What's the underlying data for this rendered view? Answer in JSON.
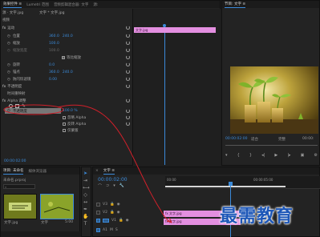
{
  "effect_controls": {
    "tabs": [
      "效果控件 ≡",
      "Lumetri 范围",
      "音频剪辑混合器: 文字",
      "源:"
    ],
    "source_selector": "源 · 文字.jpg",
    "sequence_selector": "文字 * 文字.jpg",
    "section_video": "视频",
    "motion": "运动",
    "position_label": "位置",
    "position_x": "360.0",
    "position_y": "240.0",
    "scale_label": "缩放",
    "scale_value": "100.0",
    "scale_width_label": "缩放宽度",
    "scale_width_value": "100.0",
    "uniform_scale_label": "等比缩放",
    "rotation_label": "旋转",
    "rotation_value": "0.0",
    "anchor_label": "锚点",
    "anchor_x": "360.0",
    "anchor_y": "240.0",
    "flicker_label": "防闪烁滤镜",
    "flicker_value": "0.00",
    "opacity_label": "不透明度",
    "time_remap_label": "时间重映射",
    "alpha_label": "Alpha 调整",
    "alpha_opacity_label": "不透明度",
    "alpha_opacity_value": "100.0 %",
    "ignore_alpha_label": "忽略 Alpha",
    "invert_alpha_label": "反转 Alpha",
    "mask_only_label": "仅蒙版",
    "clip_bar_label": "文字.jpg"
  },
  "program": {
    "title": "节目: 文字 ≡",
    "timecode": "00:00:02:00",
    "fit_label": "适合",
    "quality_label": "完整",
    "end_timecode": "00:00:"
  },
  "project": {
    "tabs": [
      "项目: 未命名",
      "媒体浏览器"
    ],
    "search_placeholder": "",
    "file_name": "未命名.prproj",
    "item1_name": "文字.jpg",
    "item2_name": "文字",
    "item2_duration": "5:00"
  },
  "timeline": {
    "title": "文字 ≡",
    "timecode": "00:00:02:00",
    "ruler_labels": [
      "00:00",
      "00:00:05:00"
    ],
    "tracks": [
      {
        "name": "V3"
      },
      {
        "name": "V2"
      },
      {
        "name": "V1"
      },
      {
        "name": "A1"
      }
    ],
    "clip_top": "fx 文字.jpg",
    "clip_bottom": "fx 文字.jpg"
  },
  "watermark": "最需教育",
  "colors": {
    "accent": "#3b8ad9",
    "clip_pink": "#e38fe0",
    "annotation_red": "#d0202a"
  }
}
